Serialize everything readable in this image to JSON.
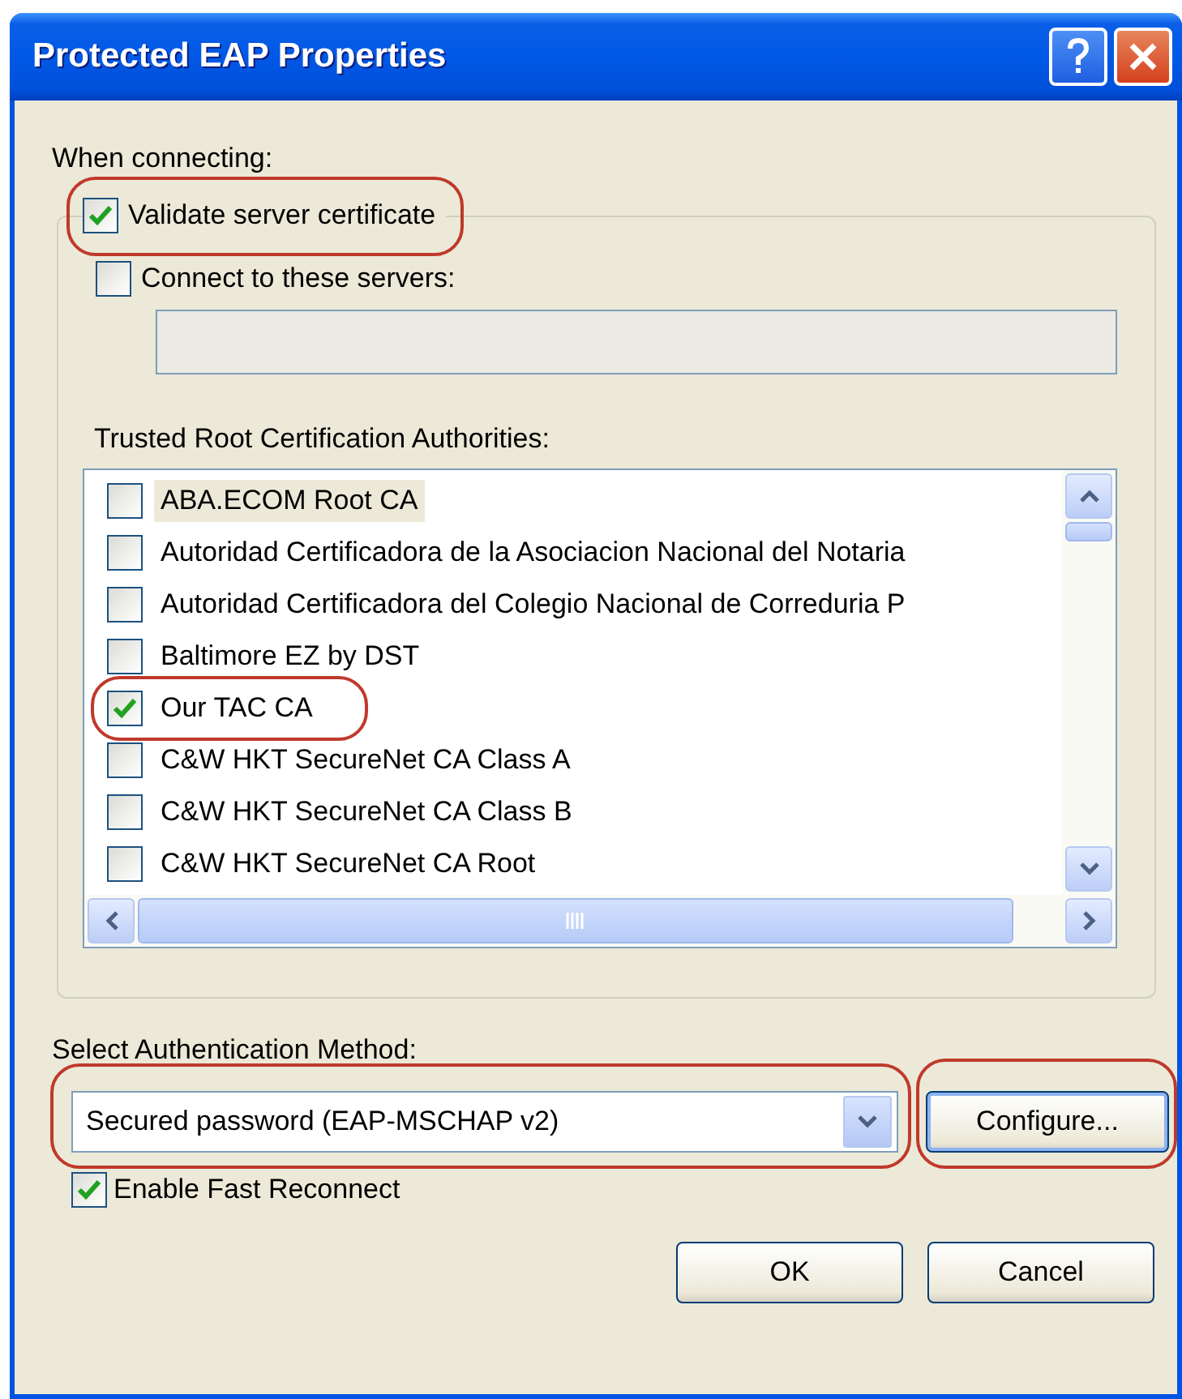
{
  "window": {
    "title": "Protected EAP Properties"
  },
  "when_connecting_label": "When connecting:",
  "validate_server_certificate": {
    "label": "Validate server certificate",
    "checked": true,
    "highlighted": true
  },
  "connect_to_servers": {
    "label": "Connect to these servers:",
    "checked": false
  },
  "servers_field": {
    "disabled": true
  },
  "trusted_root_label": "Trusted Root Certification Authorities:",
  "certificate_authorities": [
    {
      "label": "ABA.ECOM Root CA",
      "checked": false,
      "selected": true,
      "highlighted": false
    },
    {
      "label": "Autoridad Certificadora de la Asociacion Nacional del Notaria",
      "checked": false,
      "selected": false,
      "highlighted": false
    },
    {
      "label": "Autoridad Certificadora del Colegio Nacional de Correduria P",
      "checked": false,
      "selected": false,
      "highlighted": false
    },
    {
      "label": "Baltimore EZ by DST",
      "checked": false,
      "selected": false,
      "highlighted": false
    },
    {
      "label": "Our TAC CA",
      "checked": true,
      "selected": false,
      "highlighted": true
    },
    {
      "label": "C&W HKT SecureNet CA Class A",
      "checked": false,
      "selected": false,
      "highlighted": false
    },
    {
      "label": "C&W HKT SecureNet CA Class B",
      "checked": false,
      "selected": false,
      "highlighted": false
    },
    {
      "label": "C&W HKT SecureNet CA Root",
      "checked": false,
      "selected": false,
      "highlighted": false
    }
  ],
  "auth_method_label": "Select Authentication Method:",
  "auth_method": {
    "value": "Secured password (EAP-MSCHAP v2)",
    "highlighted": true
  },
  "configure_button": {
    "label": "Configure...",
    "highlighted": true
  },
  "fast_reconnect": {
    "label": "Enable Fast Reconnect",
    "checked": true
  },
  "buttons": [
    {
      "label": "OK"
    },
    {
      "label": "Cancel"
    }
  ]
}
